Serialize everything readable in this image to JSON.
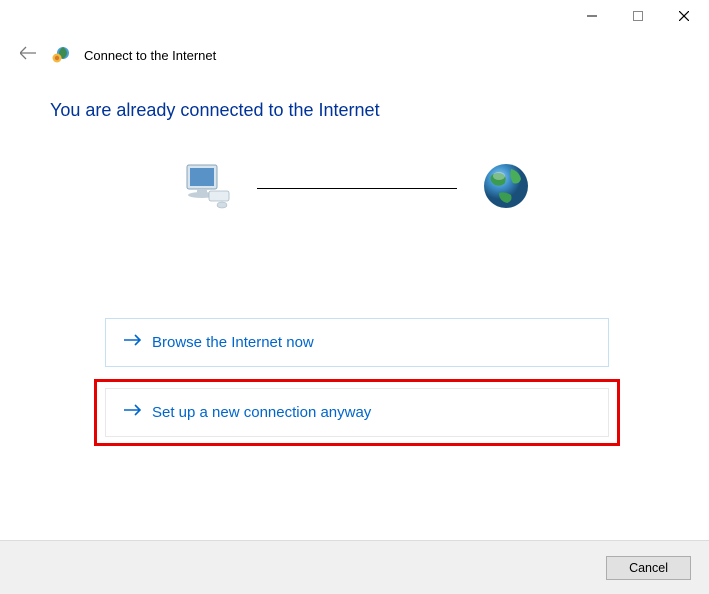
{
  "titlebar": {
    "minimize": "—",
    "maximize": "□",
    "close": "✕"
  },
  "header": {
    "title": "Connect to the Internet"
  },
  "heading": "You are already connected to the Internet",
  "options": {
    "browse": "Browse the Internet now",
    "setup": "Set up a new connection anyway"
  },
  "footer": {
    "cancel": "Cancel"
  }
}
